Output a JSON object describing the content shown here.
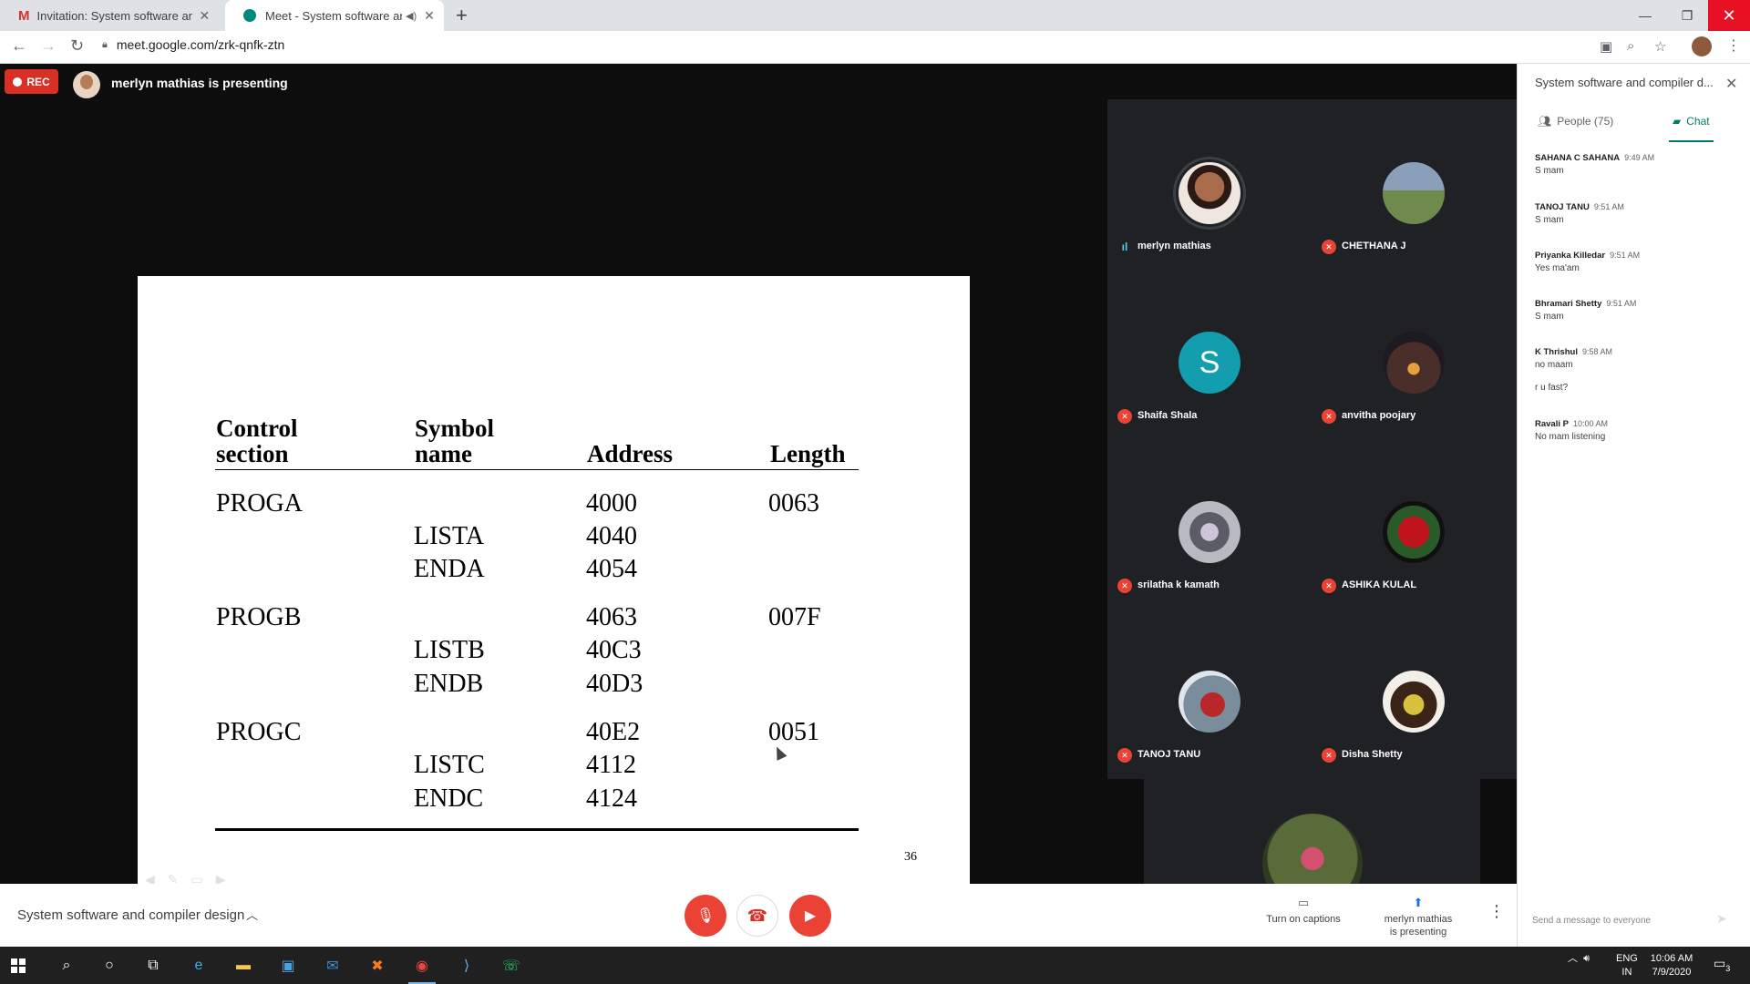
{
  "browser": {
    "tabs": [
      {
        "title": "Invitation: System software and c"
      },
      {
        "title": "Meet - System software and"
      }
    ],
    "url": "meet.google.com/zrk-qnfk-ztn"
  },
  "stage": {
    "rec_label": "REC",
    "presenting_text": "merlyn mathias is presenting"
  },
  "slide": {
    "headers": {
      "control_section": [
        "Control",
        "section"
      ],
      "symbol_name": [
        "Symbol",
        "name"
      ],
      "address": "Address",
      "length": "Length"
    },
    "rows": [
      {
        "control": "PROGA",
        "symbol": "",
        "address": "4000",
        "length": "0063"
      },
      {
        "control": "",
        "symbol": "LISTA",
        "address": "4040",
        "length": ""
      },
      {
        "control": "",
        "symbol": "ENDA",
        "address": "4054",
        "length": ""
      },
      {
        "control": "PROGB",
        "symbol": "",
        "address": "4063",
        "length": "007F"
      },
      {
        "control": "",
        "symbol": "LISTB",
        "address": "40C3",
        "length": ""
      },
      {
        "control": "",
        "symbol": "ENDB",
        "address": "40D3",
        "length": ""
      },
      {
        "control": "PROGC",
        "symbol": "",
        "address": "40E2",
        "length": "0051"
      },
      {
        "control": "",
        "symbol": "LISTC",
        "address": "4112",
        "length": ""
      },
      {
        "control": "",
        "symbol": "ENDC",
        "address": "4124",
        "length": ""
      }
    ],
    "page_number": "36"
  },
  "participants": [
    {
      "name": "merlyn mathias",
      "speaking": true
    },
    {
      "name": "CHETHANA J",
      "muted": true
    },
    {
      "name": "Shaifa Shala",
      "muted": true,
      "initial": "S"
    },
    {
      "name": "anvitha poojary",
      "muted": true
    },
    {
      "name": "srilatha k kamath",
      "muted": true
    },
    {
      "name": "ASHIKA KULAL",
      "muted": true
    },
    {
      "name": "TANOJ TANU",
      "muted": true
    },
    {
      "name": "Disha Shetty",
      "muted": true
    }
  ],
  "callbar": {
    "meeting_title": "System software and compiler design",
    "captions_label": "Turn on captions",
    "present_label_1": "merlyn mathias",
    "present_label_2": "is presenting"
  },
  "side_panel": {
    "title": "System software and compiler d...",
    "people_tab": "People (75)",
    "chat_tab": "Chat",
    "messages": [
      {
        "sender": "SAHANA C SAHANA",
        "time": "9:49 AM",
        "text": "S mam"
      },
      {
        "sender": "TANOJ TANU",
        "time": "9:51 AM",
        "text": "S mam"
      },
      {
        "sender": "Priyanka Killedar",
        "time": "9:51 AM",
        "text": "Yes ma'am"
      },
      {
        "sender": "Bhramari Shetty",
        "time": "9:51 AM",
        "text": "S mam"
      },
      {
        "sender": "K Thrishul",
        "time": "9:58 AM",
        "text": "no maam",
        "text2": "r u fast?"
      },
      {
        "sender": "Ravali P",
        "time": "10:00 AM",
        "text": "No mam listening"
      }
    ],
    "input_placeholder": "Send a message to everyone"
  },
  "taskbar": {
    "lang_1": "ENG",
    "lang_2": "IN",
    "time": "10:06 AM",
    "date": "7/9/2020",
    "notifications": "3"
  },
  "colors": {
    "rec_red": "#d93025",
    "accent_teal": "#00796b",
    "muted_red": "#ea4335"
  }
}
